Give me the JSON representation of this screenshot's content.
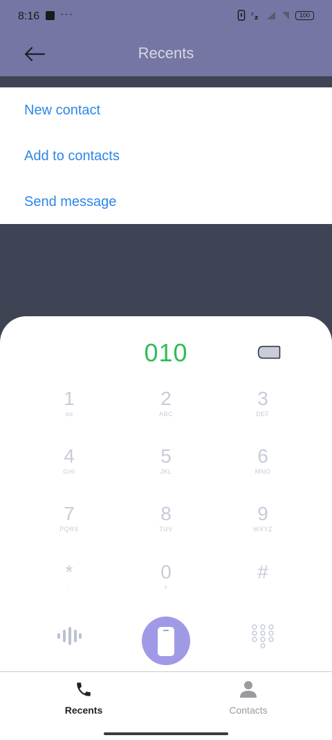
{
  "status_bar": {
    "time": "8:16",
    "dots": "···",
    "battery": "100"
  },
  "app_bar": {
    "title": "Recents"
  },
  "menu": {
    "items": [
      {
        "label": "New contact"
      },
      {
        "label": "Add to contacts"
      },
      {
        "label": "Send message"
      }
    ]
  },
  "dialer": {
    "number": "010",
    "keys": [
      {
        "digit": "1",
        "letters": "ᴏᴏ"
      },
      {
        "digit": "2",
        "letters": "ABC"
      },
      {
        "digit": "3",
        "letters": "DEF"
      },
      {
        "digit": "4",
        "letters": "GHI"
      },
      {
        "digit": "5",
        "letters": "JKL"
      },
      {
        "digit": "6",
        "letters": "MNO"
      },
      {
        "digit": "7",
        "letters": "PQRS"
      },
      {
        "digit": "8",
        "letters": "TUV"
      },
      {
        "digit": "9",
        "letters": "WXYZ"
      },
      {
        "digit": "*",
        "letters": "·"
      },
      {
        "digit": "0",
        "letters": "+"
      },
      {
        "digit": "#",
        "letters": ""
      }
    ]
  },
  "tabs": [
    {
      "label": "Recents",
      "icon": "phone-icon",
      "active": true
    },
    {
      "label": "Contacts",
      "icon": "person-icon",
      "active": false
    }
  ],
  "colors": {
    "header": "#7676a4",
    "accent_blue": "#2d86e8",
    "number_green": "#2fbd57",
    "call_button": "#a09ae6",
    "key_gray": "#c7cbda",
    "scrim": "#3f4454"
  }
}
